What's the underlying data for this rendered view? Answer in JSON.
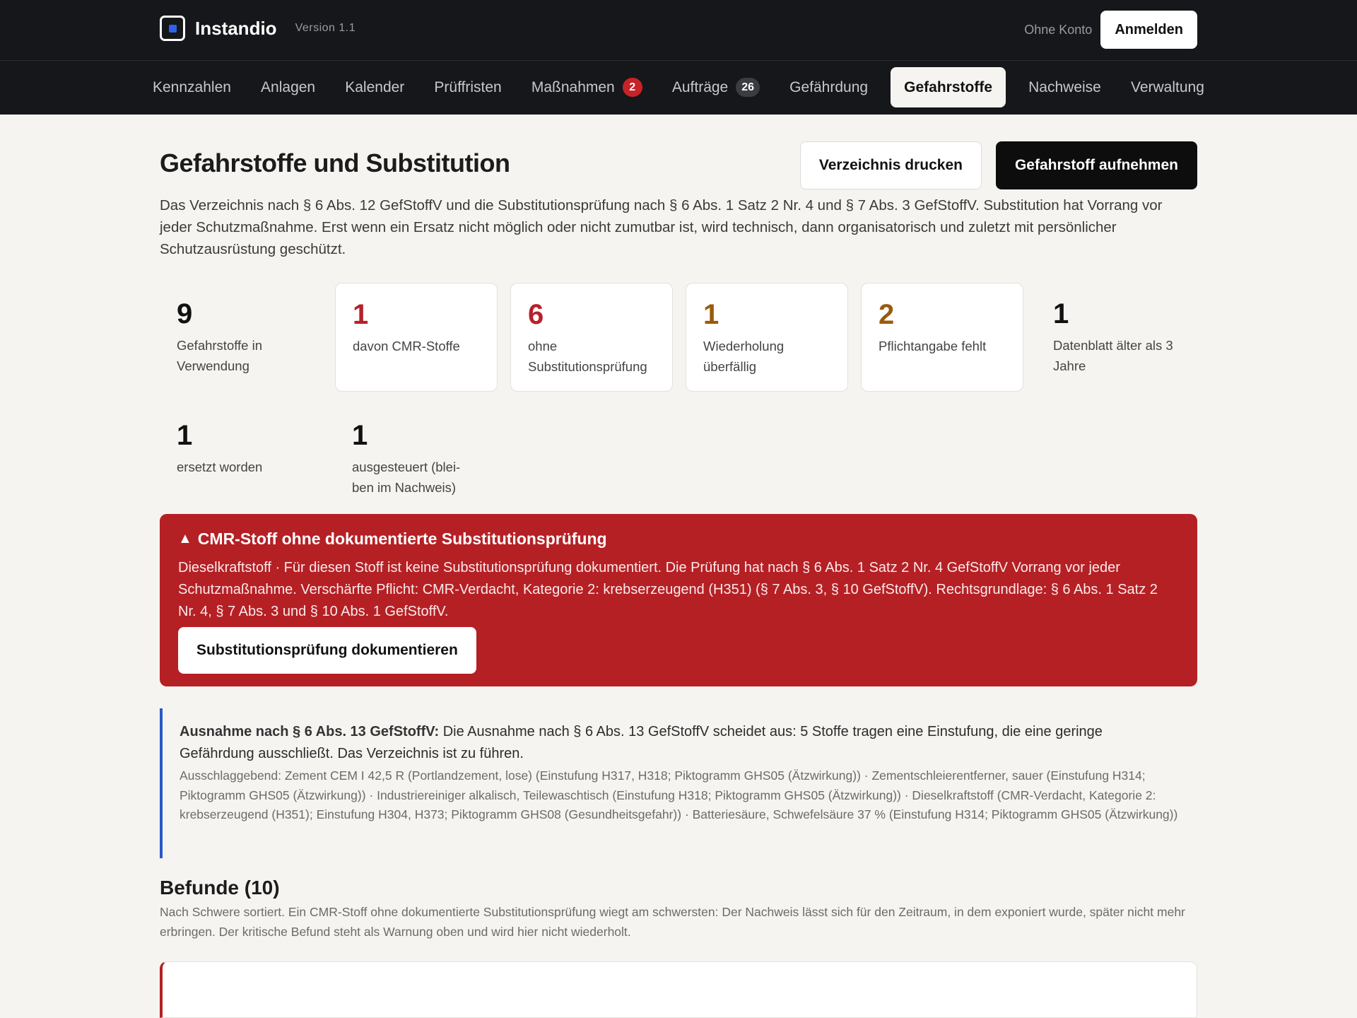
{
  "app": {
    "name": "Instandio",
    "version": "Version 1.1"
  },
  "account": {
    "status": "Ohne Konto",
    "login_label": "Anmelden"
  },
  "nav": {
    "tabs": [
      {
        "label": "Kennzahlen"
      },
      {
        "label": "Anlagen"
      },
      {
        "label": "Kalender"
      },
      {
        "label": "Prüffristen"
      },
      {
        "label": "Maßnahmen",
        "badge": "2"
      },
      {
        "label": "Aufträge",
        "badge": "26"
      },
      {
        "label": "Gefährdung"
      },
      {
        "label": "Gefahrstoffe",
        "active": true
      },
      {
        "label": "Nachweise"
      },
      {
        "label": "Verwaltung"
      }
    ]
  },
  "page": {
    "title": "Gefahrstoffe und Substitution",
    "print_label": "Verzeichnis drucken",
    "add_label": "Gefahrstoff aufnehmen",
    "intro": "Das Verzeichnis nach § 6 Abs. 12 GefStoffV und die Substitutionsprüfung nach § 6 Abs. 1 Satz 2 Nr. 4 und § 7 Abs. 3 GefStoffV. Substitution hat Vorrang vor jeder Schutzmaßnahme. Erst wenn ein Ersatz nicht möglich oder nicht zumutbar ist, wird technisch, dann organisatorisch und zuletzt mit persönlicher Schutzausrüstung geschützt."
  },
  "stats": [
    {
      "value": "9",
      "label": "Gefahrstoffe in Verwendung"
    },
    {
      "value": "1",
      "label": "davon CMR-Stoffe",
      "color": "#b8202a"
    },
    {
      "value": "6",
      "label": "ohne Substitutionsprüfung",
      "color": "#b8202a"
    },
    {
      "value": "1",
      "label": "Wiederholung überfällig",
      "color": "#9a5a0c"
    },
    {
      "value": "2",
      "label": "Pflichtangabe fehlt",
      "color": "#9a5a0c"
    },
    {
      "value": "1",
      "label": "Datenblatt älter als 3 Jahre"
    },
    {
      "value": "1",
      "label": "ersetzt worden"
    },
    {
      "value": "1",
      "label": "ausgesteuert (blei-ben im Nachweis)"
    }
  ],
  "alert": {
    "icon": "warning-triangle-icon",
    "title": "CMR-Stoff ohne dokumentierte Substitutionsprüfung",
    "text": "Dieselkraftstoff · Für diesen Stoff ist keine Substitutionsprüfung dokumentiert. Die Prüfung hat nach § 6 Abs. 1 Satz 2 Nr. 4 GefStoffV Vorrang vor jeder Schutzmaßnahme. Verschärfte Pflicht: CMR-Verdacht, Kategorie 2: krebserzeugend (H351) (§ 7 Abs. 3, § 10 GefStoffV). Rechtsgrundlage: § 6 Abs. 1 Satz 2 Nr. 4, § 7 Abs. 3 und § 10 Abs. 1 GefStoffV.",
    "button_label": "Substitutionsprüfung dokumentieren",
    "color": "#b52025"
  },
  "exception": {
    "lead": "Ausnahme nach § 6 Abs. 13 GefStoffV:",
    "text": " Die Ausnahme nach § 6 Abs. 13 GefStoffV scheidet aus: 5 Stoffe tragen eine Einstufung, die eine geringe Gefährdung ausschließt. Das Verzeichnis ist zu führen.",
    "detail": "Ausschlaggebend: Zement CEM I 42,5 R (Portlandzement, lose) (Einstufung H317, H318; Piktogramm GHS05 (Ätzwirkung)) · Zementschleierentferner, sauer (Einstufung H314; Piktogramm GHS05 (Ätzwirkung)) · Industriereiniger alkalisch, Teilewaschtisch (Einstufung H318; Piktogramm GHS05 (Ätzwirkung)) · Dieselkraftstoff (CMR-Verdacht, Kategorie 2: krebserzeugend (H351); Einstufung H304, H373; Piktogramm GHS08 (Gesundheitsgefahr)) · Batteriesäure, Schwefelsäure 37 % (Einstufung H314; Piktogramm GHS05 (Ätzwirkung))"
  },
  "findings": {
    "title": "Befunde (10)",
    "text": "Nach Schwere sortiert. Ein CMR-Stoff ohne dokumentierte Substitutionsprüfung wiegt am schwersten: Der Nachweis lässt sich für den Zeitraum, in dem exponiert wurde, später nicht mehr erbringen. Der kritische Befund steht als Warnung oben und wird hier nicht wiederholt."
  }
}
